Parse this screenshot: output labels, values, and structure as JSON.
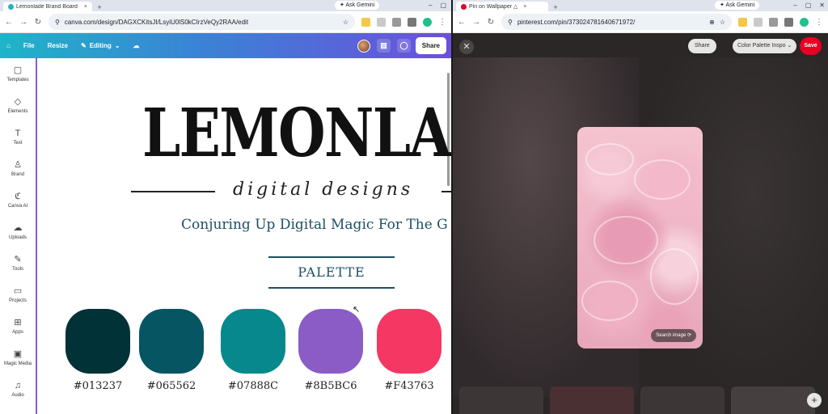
{
  "left_window": {
    "tab": {
      "title": "Lemonlade Brand Board - Bran",
      "close": "×"
    },
    "new_tab": "+",
    "gemini": "Ask Gemini",
    "url": "canva.com/design/DAGXCKitsJI/LsyiU0lS0kCIrzVeQy2RAA/edit",
    "canva_toolbar": {
      "home": "⌂",
      "file": "File",
      "resize": "Resize",
      "editing": "Editing",
      "share": "Share"
    },
    "sidebar": [
      {
        "id": "templates",
        "icon": "▢",
        "label": "Templates"
      },
      {
        "id": "elements",
        "icon": "◇",
        "label": "Elements"
      },
      {
        "id": "text",
        "icon": "T",
        "label": "Text"
      },
      {
        "id": "brand",
        "icon": "♙",
        "label": "Brand"
      },
      {
        "id": "canva-ai",
        "icon": "ℭ",
        "label": "Canva AI"
      },
      {
        "id": "uploads",
        "icon": "☁",
        "label": "Uploads"
      },
      {
        "id": "tools",
        "icon": "✎",
        "label": "Tools"
      },
      {
        "id": "projects",
        "icon": "▭",
        "label": "Projects"
      },
      {
        "id": "apps",
        "icon": "⊞",
        "label": "Apps"
      },
      {
        "id": "magic-media",
        "icon": "▣",
        "label": "Magic Media"
      },
      {
        "id": "audio",
        "icon": "♫",
        "label": "Audio"
      }
    ],
    "design": {
      "brand_title": "LEMONLAI",
      "tagline": "digital designs",
      "subtitle": "Conjuring Up Digital Magic For The G",
      "palette_heading": "PALETTE",
      "swatches": [
        {
          "hex_label": "#013237",
          "color": "#013237"
        },
        {
          "hex_label": "#065562",
          "color": "#065562"
        },
        {
          "hex_label": "#07888C",
          "color": "#07888C"
        },
        {
          "hex_label": "#8B5BC6",
          "color": "#8B5BC6"
        },
        {
          "hex_label": "#F43763",
          "color": "#F43763"
        }
      ]
    }
  },
  "right_window": {
    "tab": {
      "title": "Pin on Wallpaper △",
      "close": "×"
    },
    "new_tab": "+",
    "gemini": "Ask Gemini",
    "url": "pinterest.com/pin/373024781640671972/",
    "pin": {
      "close": "✕",
      "share": "Share",
      "board": "Color Palette Inspo",
      "save": "Save",
      "search_image": "Search image",
      "add": "+"
    }
  },
  "colors": {
    "canva_gradient": [
      "#1fb4c7",
      "#6d4fdc"
    ],
    "pinterest_red": "#e60023",
    "divider": "#8b5bc6"
  }
}
